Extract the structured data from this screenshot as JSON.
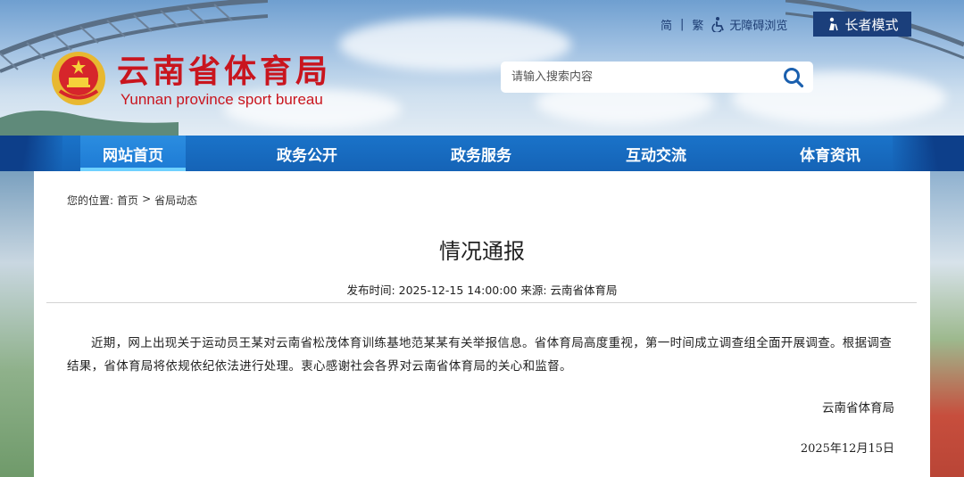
{
  "site": {
    "title": "云南省体育局",
    "subtitle": "Yunnan province sport bureau"
  },
  "top_links": {
    "simplified": "简",
    "separator": "|",
    "traditional": "繁",
    "accessibility": "无障碍浏览",
    "elder_mode": "长者模式"
  },
  "search": {
    "placeholder": "请输入搜索内容"
  },
  "nav": {
    "items": [
      {
        "label": "网站首页",
        "active": true
      },
      {
        "label": "政务公开",
        "active": false
      },
      {
        "label": "政务服务",
        "active": false
      },
      {
        "label": "互动交流",
        "active": false
      },
      {
        "label": "体育资讯",
        "active": false
      }
    ]
  },
  "breadcrumb": {
    "prefix": "您的位置:",
    "home": "首页",
    "arrow": ">",
    "current": "省局动态"
  },
  "article": {
    "title": "情况通报",
    "meta": "发布时间: 2025-12-15 14:00:00 来源: 云南省体育局",
    "body": "近期，网上出现关于运动员王某对云南省松茂体育训练基地范某某有关举报信息。省体育局高度重视，第一时间成立调查组全面开展调查。根据调查结果，省体育局将依规依纪依法进行处理。衷心感谢社会各界对云南省体育局的关心和监督。",
    "signature": "云南省体育局",
    "date": "2025年12月15日"
  },
  "colors": {
    "brand_red": "#c9151e",
    "nav_blue": "#1563b6",
    "elder_bg": "#1b3f7b"
  }
}
